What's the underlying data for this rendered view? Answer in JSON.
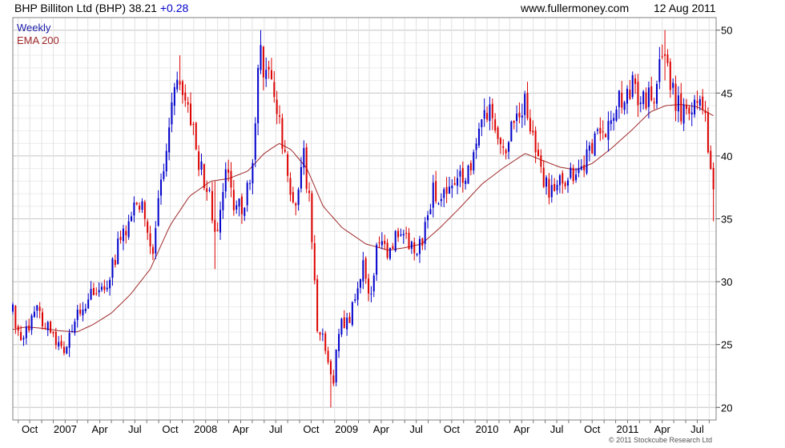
{
  "header": {
    "title": "BHP Billiton Ltd (BHP)",
    "last": "38.21",
    "change": "+0.28",
    "site": "www.fullermoney.com",
    "date": "12 Aug 2011"
  },
  "legend": {
    "weekly": "Weekly",
    "ema": "EMA 200"
  },
  "copyright": "© 2011 Stockcube Research Ltd",
  "colors": {
    "up": "#0000cc",
    "down": "#dd0000",
    "ema": "#a0282a",
    "grid": "#dcdcdc",
    "frame": "#808080"
  },
  "chart_data": {
    "type": "candlestick",
    "interval": "weekly",
    "ylim": [
      19,
      51
    ],
    "yticks": [
      20,
      25,
      30,
      35,
      40,
      45,
      50
    ],
    "grid": true,
    "legend_position": "top-left",
    "xticks": [
      {
        "label": "Oct",
        "date": "2006-10-01"
      },
      {
        "label": "2007",
        "date": "2007-01-01"
      },
      {
        "label": "Apr",
        "date": "2007-04-01"
      },
      {
        "label": "Jul",
        "date": "2007-07-01"
      },
      {
        "label": "Oct",
        "date": "2007-10-01"
      },
      {
        "label": "2008",
        "date": "2008-01-01"
      },
      {
        "label": "Apr",
        "date": "2008-04-01"
      },
      {
        "label": "Jul",
        "date": "2008-07-01"
      },
      {
        "label": "Oct",
        "date": "2008-10-01"
      },
      {
        "label": "2009",
        "date": "2009-01-01"
      },
      {
        "label": "Apr",
        "date": "2009-04-01"
      },
      {
        "label": "Jul",
        "date": "2009-07-01"
      },
      {
        "label": "Oct",
        "date": "2009-10-01"
      },
      {
        "label": "2010",
        "date": "2010-01-01"
      },
      {
        "label": "Apr",
        "date": "2010-04-01"
      },
      {
        "label": "Jul",
        "date": "2010-07-01"
      },
      {
        "label": "Oct",
        "date": "2010-10-01"
      },
      {
        "label": "2011",
        "date": "2011-01-01"
      },
      {
        "label": "Apr",
        "date": "2011-04-01"
      },
      {
        "label": "Jul",
        "date": "2011-07-01"
      }
    ],
    "price_path": [
      [
        "2006-08-18",
        27.6
      ],
      [
        "2006-09-10",
        25.0
      ],
      [
        "2006-10-20",
        27.8
      ],
      [
        "2006-11-30",
        25.6
      ],
      [
        "2007-01-01",
        24.5
      ],
      [
        "2007-01-20",
        26.5
      ],
      [
        "2007-02-20",
        28.2
      ],
      [
        "2007-03-20",
        29.5
      ],
      [
        "2007-04-20",
        30.0
      ],
      [
        "2007-05-20",
        33.0
      ],
      [
        "2007-06-20",
        35.0
      ],
      [
        "2007-07-20",
        37.0
      ],
      [
        "2007-08-15",
        32.5
      ],
      [
        "2007-09-10",
        38.5
      ],
      [
        "2007-10-01",
        43.0
      ],
      [
        "2007-10-25",
        46.5
      ],
      [
        "2007-11-20",
        43.0
      ],
      [
        "2007-12-20",
        39.0
      ],
      [
        "2008-01-10",
        37.0
      ],
      [
        "2008-01-25",
        33.5
      ],
      [
        "2008-02-20",
        38.5
      ],
      [
        "2008-03-20",
        36.0
      ],
      [
        "2008-04-10",
        35.5
      ],
      [
        "2008-05-01",
        40.0
      ],
      [
        "2008-05-20",
        48.5
      ],
      [
        "2008-06-10",
        46.0
      ],
      [
        "2008-07-01",
        44.5
      ],
      [
        "2008-07-25",
        40.0
      ],
      [
        "2008-08-20",
        36.0
      ],
      [
        "2008-09-10",
        40.5
      ],
      [
        "2008-10-01",
        35.0
      ],
      [
        "2008-10-15",
        26.5
      ],
      [
        "2008-11-05",
        25.0
      ],
      [
        "2008-11-25",
        21.5
      ],
      [
        "2008-12-15",
        27.0
      ],
      [
        "2009-01-10",
        27.0
      ],
      [
        "2009-02-10",
        31.5
      ],
      [
        "2009-03-01",
        28.0
      ],
      [
        "2009-03-20",
        33.0
      ],
      [
        "2009-04-20",
        32.5
      ],
      [
        "2009-05-20",
        34.5
      ],
      [
        "2009-06-20",
        32.5
      ],
      [
        "2009-07-15",
        33.0
      ],
      [
        "2009-08-10",
        37.0
      ],
      [
        "2009-09-10",
        37.0
      ],
      [
        "2009-10-10",
        38.5
      ],
      [
        "2009-11-10",
        38.0
      ],
      [
        "2009-12-10",
        42.0
      ],
      [
        "2010-01-15",
        43.5
      ],
      [
        "2010-02-10",
        40.5
      ],
      [
        "2010-03-10",
        42.5
      ],
      [
        "2010-04-10",
        44.0
      ],
      [
        "2010-04-25",
        42.0
      ],
      [
        "2010-05-20",
        38.5
      ],
      [
        "2010-06-10",
        37.5
      ],
      [
        "2010-07-10",
        38.0
      ],
      [
        "2010-08-10",
        38.5
      ],
      [
        "2010-09-10",
        39.5
      ],
      [
        "2010-10-10",
        41.0
      ],
      [
        "2010-11-10",
        42.5
      ],
      [
        "2010-12-10",
        44.5
      ],
      [
        "2011-01-15",
        45.5
      ],
      [
        "2011-02-10",
        44.0
      ],
      [
        "2011-03-10",
        45.0
      ],
      [
        "2011-04-01",
        47.5
      ],
      [
        "2011-04-20",
        46.0
      ],
      [
        "2011-05-10",
        44.0
      ],
      [
        "2011-06-10",
        43.5
      ],
      [
        "2011-07-01",
        44.0
      ],
      [
        "2011-07-20",
        43.0
      ],
      [
        "2011-08-04",
        38.5
      ],
      [
        "2011-08-12",
        38.2
      ]
    ],
    "extremes": [
      [
        "2007-01-12",
        24.0,
        25.6
      ],
      [
        "2007-10-27",
        46.0,
        48.0
      ],
      [
        "2008-01-25",
        31.0,
        38.0
      ],
      [
        "2008-05-23",
        46.5,
        50.0
      ],
      [
        "2008-11-21",
        20.0,
        22.5
      ],
      [
        "2011-04-08",
        46.0,
        50.0
      ],
      [
        "2011-08-12",
        34.8,
        38.4
      ]
    ],
    "ema_path": [
      [
        "2006-08-18",
        26.2
      ],
      [
        "2006-09-20",
        26.4
      ],
      [
        "2006-11-01",
        26.3
      ],
      [
        "2006-12-15",
        26.1
      ],
      [
        "2007-02-01",
        26.0
      ],
      [
        "2007-03-15",
        26.6
      ],
      [
        "2007-05-01",
        27.5
      ],
      [
        "2007-06-20",
        29.0
      ],
      [
        "2007-08-10",
        31.0
      ],
      [
        "2007-10-01",
        34.5
      ],
      [
        "2007-11-20",
        36.8
      ],
      [
        "2008-01-15",
        38.0
      ],
      [
        "2008-03-01",
        38.2
      ],
      [
        "2008-04-20",
        38.8
      ],
      [
        "2008-06-01",
        40.2
      ],
      [
        "2008-07-10",
        41.0
      ],
      [
        "2008-08-10",
        40.5
      ],
      [
        "2008-09-20",
        39.0
      ],
      [
        "2008-11-01",
        36.0
      ],
      [
        "2008-12-20",
        34.3
      ],
      [
        "2009-02-20",
        33.0
      ],
      [
        "2009-04-20",
        32.5
      ],
      [
        "2009-06-01",
        32.7
      ],
      [
        "2009-07-15",
        33.0
      ],
      [
        "2009-09-01",
        34.3
      ],
      [
        "2009-10-20",
        35.8
      ],
      [
        "2009-12-20",
        37.8
      ],
      [
        "2010-02-10",
        39.0
      ],
      [
        "2010-04-10",
        40.2
      ],
      [
        "2010-05-20",
        39.7
      ],
      [
        "2010-07-10",
        39.1
      ],
      [
        "2010-08-20",
        38.9
      ],
      [
        "2010-10-01",
        39.4
      ],
      [
        "2010-11-20",
        40.6
      ],
      [
        "2011-01-10",
        42.0
      ],
      [
        "2011-03-01",
        43.5
      ],
      [
        "2011-04-10",
        44.0
      ],
      [
        "2011-05-20",
        44.1
      ],
      [
        "2011-07-01",
        43.9
      ],
      [
        "2011-08-12",
        43.2
      ]
    ]
  }
}
